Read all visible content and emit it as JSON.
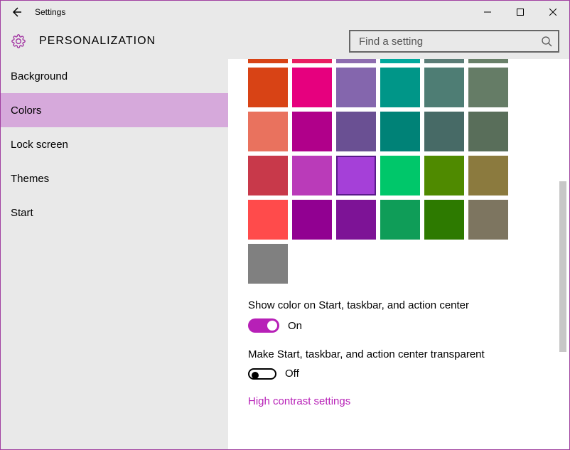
{
  "window": {
    "title": "Settings"
  },
  "header": {
    "category": "PERSONALIZATION"
  },
  "search": {
    "placeholder": "Find a setting"
  },
  "sidebar": {
    "items": [
      {
        "label": "Background"
      },
      {
        "label": "Colors"
      },
      {
        "label": "Lock screen"
      },
      {
        "label": "Themes"
      },
      {
        "label": "Start"
      }
    ],
    "selected_index": 1
  },
  "colors": {
    "partial_row": [
      "#d84315",
      "#e91e63",
      "#8e6db0",
      "#00a99d",
      "#5b7d77",
      "#698069"
    ],
    "rows": [
      [
        "#d84315",
        "#e6007e",
        "#8466ad",
        "#009688",
        "#4e7d74",
        "#657c66"
      ],
      [
        "#e9725e",
        "#b0008a",
        "#6a5093",
        "#008277",
        "#476a66",
        "#596e5a"
      ],
      [
        "#c8394a",
        "#ba3bb9",
        "#a540d8",
        "#00c76a",
        "#4f8a00",
        "#8b7a3e"
      ],
      [
        "#ff4b4b",
        "#910091",
        "#7d1396",
        "#0f9d58",
        "#2d7a00",
        "#7d7560"
      ]
    ],
    "extra": [
      "#808080"
    ],
    "selected": {
      "row": 2,
      "col": 2
    },
    "accent": "#a540d8"
  },
  "settings": {
    "show_color_label": "Show color on Start, taskbar, and action center",
    "show_color_value": "On",
    "show_color_on": true,
    "transparent_label": "Make Start, taskbar, and action center transparent",
    "transparent_value": "Off",
    "transparent_on": false,
    "high_contrast_link": "High contrast settings"
  }
}
